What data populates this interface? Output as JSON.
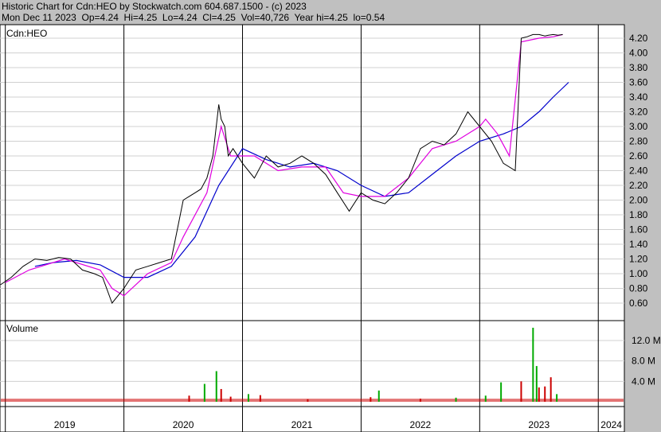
{
  "header": {
    "line1": "Historic Chart for Cdn:HEO by Stockwatch.com 604.687.1500 - (c) 2023",
    "line2": "Mon Dec 11 2023  Op=4.24  Hi=4.25  Lo=4.24  Cl=4.25  Vol=40,726  Year hi=4.25  lo=0.54"
  },
  "chart_data": [
    {
      "type": "line",
      "title": "Cdn:HEO",
      "ylim": [
        0.4,
        4.35
      ],
      "yticks": [
        "0.60",
        "0.80",
        "1.00",
        "1.20",
        "1.40",
        "1.60",
        "1.80",
        "2.00",
        "2.20",
        "2.40",
        "2.60",
        "2.80",
        "3.00",
        "3.20",
        "3.40",
        "3.60",
        "3.80",
        "4.00",
        "4.20"
      ],
      "x_years": [
        "2019",
        "2020",
        "2021",
        "2022",
        "2023",
        "2024"
      ],
      "grid": true,
      "colors": {
        "price": "#000000",
        "ma_short": "#e000e0",
        "ma_long": "#0000cc"
      },
      "series": [
        {
          "kind": "price",
          "x": [
            2018.96,
            2019.05,
            2019.15,
            2019.25,
            2019.35,
            2019.45,
            2019.55,
            2019.65,
            2019.75,
            2019.82,
            2019.9,
            2020.0,
            2020.1,
            2020.2,
            2020.3,
            2020.4,
            2020.5,
            2020.55,
            2020.6,
            2020.65,
            2020.7,
            2020.75,
            2020.8,
            2020.82,
            2020.85,
            2020.88,
            2020.92,
            2021.0,
            2021.1,
            2021.2,
            2021.3,
            2021.4,
            2021.5,
            2021.6,
            2021.7,
            2021.8,
            2021.9,
            2022.0,
            2022.1,
            2022.2,
            2022.3,
            2022.4,
            2022.5,
            2022.6,
            2022.7,
            2022.8,
            2022.9,
            2023.0,
            2023.1,
            2023.2,
            2023.3,
            2023.35,
            2023.4,
            2023.45,
            2023.5,
            2023.55,
            2023.58,
            2023.62,
            2023.66,
            2023.7
          ],
          "values": [
            0.85,
            0.95,
            1.1,
            1.2,
            1.18,
            1.22,
            1.2,
            1.05,
            1.0,
            0.95,
            0.6,
            0.8,
            1.05,
            1.1,
            1.15,
            1.2,
            2.0,
            2.05,
            2.1,
            2.15,
            2.3,
            2.6,
            3.3,
            3.1,
            3.0,
            2.6,
            2.7,
            2.5,
            2.3,
            2.6,
            2.45,
            2.5,
            2.6,
            2.5,
            2.35,
            2.1,
            1.85,
            2.1,
            2.0,
            1.95,
            2.1,
            2.3,
            2.7,
            2.8,
            2.75,
            2.9,
            3.2,
            3.0,
            2.8,
            2.5,
            2.4,
            4.2,
            4.22,
            4.25,
            4.25,
            4.23,
            4.24,
            4.25,
            4.24,
            4.25
          ]
        },
        {
          "kind": "ma_short",
          "x": [
            2019.0,
            2019.2,
            2019.5,
            2019.8,
            2019.9,
            2020.0,
            2020.2,
            2020.4,
            2020.5,
            2020.7,
            2020.82,
            2020.9,
            2021.1,
            2021.3,
            2021.5,
            2021.7,
            2021.85,
            2022.0,
            2022.2,
            2022.4,
            2022.6,
            2022.8,
            2023.0,
            2023.05,
            2023.15,
            2023.25,
            2023.35,
            2023.5,
            2023.62,
            2023.7
          ],
          "values": [
            0.88,
            1.05,
            1.2,
            1.05,
            0.8,
            0.7,
            1.0,
            1.15,
            1.5,
            2.1,
            3.0,
            2.6,
            2.6,
            2.4,
            2.45,
            2.45,
            2.1,
            2.05,
            2.05,
            2.3,
            2.7,
            2.8,
            3.0,
            3.1,
            2.9,
            2.6,
            4.15,
            4.2,
            4.22,
            4.25
          ]
        },
        {
          "kind": "ma_long",
          "x": [
            2019.25,
            2019.4,
            2019.6,
            2019.8,
            2020.0,
            2020.2,
            2020.4,
            2020.6,
            2020.8,
            2021.0,
            2021.2,
            2021.4,
            2021.6,
            2021.8,
            2022.0,
            2022.2,
            2022.4,
            2022.6,
            2022.8,
            2023.0,
            2023.2,
            2023.35,
            2023.5,
            2023.62,
            2023.75
          ],
          "values": [
            1.1,
            1.15,
            1.18,
            1.12,
            0.95,
            0.95,
            1.1,
            1.5,
            2.2,
            2.7,
            2.55,
            2.45,
            2.5,
            2.4,
            2.2,
            2.05,
            2.1,
            2.35,
            2.6,
            2.8,
            2.9,
            3.0,
            3.2,
            3.4,
            3.6
          ]
        }
      ]
    },
    {
      "type": "bar",
      "title": "Volume",
      "ylim": [
        0,
        15
      ],
      "yticks": [
        "4.0 M",
        "8.0 M",
        "12.0 M"
      ],
      "spikes": [
        {
          "x": 2020.55,
          "value": 1.2,
          "color": "#cc0000"
        },
        {
          "x": 2020.68,
          "value": 3.5,
          "color": "#00aa00"
        },
        {
          "x": 2020.78,
          "value": 6.0,
          "color": "#00aa00"
        },
        {
          "x": 2020.82,
          "value": 2.5,
          "color": "#cc0000"
        },
        {
          "x": 2020.9,
          "value": 1.0,
          "color": "#cc0000"
        },
        {
          "x": 2021.05,
          "value": 1.5,
          "color": "#00aa00"
        },
        {
          "x": 2021.15,
          "value": 1.3,
          "color": "#cc0000"
        },
        {
          "x": 2021.55,
          "value": 0.5,
          "color": "#cc0000"
        },
        {
          "x": 2022.08,
          "value": 0.9,
          "color": "#cc0000"
        },
        {
          "x": 2022.15,
          "value": 2.2,
          "color": "#00aa00"
        },
        {
          "x": 2022.5,
          "value": 0.6,
          "color": "#cc0000"
        },
        {
          "x": 2022.8,
          "value": 0.8,
          "color": "#00aa00"
        },
        {
          "x": 2023.05,
          "value": 1.2,
          "color": "#00aa00"
        },
        {
          "x": 2023.18,
          "value": 3.8,
          "color": "#00aa00"
        },
        {
          "x": 2023.35,
          "value": 4.0,
          "color": "#cc0000"
        },
        {
          "x": 2023.45,
          "value": 14.5,
          "color": "#00aa00"
        },
        {
          "x": 2023.48,
          "value": 7.0,
          "color": "#00aa00"
        },
        {
          "x": 2023.5,
          "value": 2.8,
          "color": "#cc0000"
        },
        {
          "x": 2023.55,
          "value": 3.0,
          "color": "#cc0000"
        },
        {
          "x": 2023.6,
          "value": 4.8,
          "color": "#cc0000"
        },
        {
          "x": 2023.65,
          "value": 1.5,
          "color": "#00aa00"
        }
      ]
    }
  ]
}
